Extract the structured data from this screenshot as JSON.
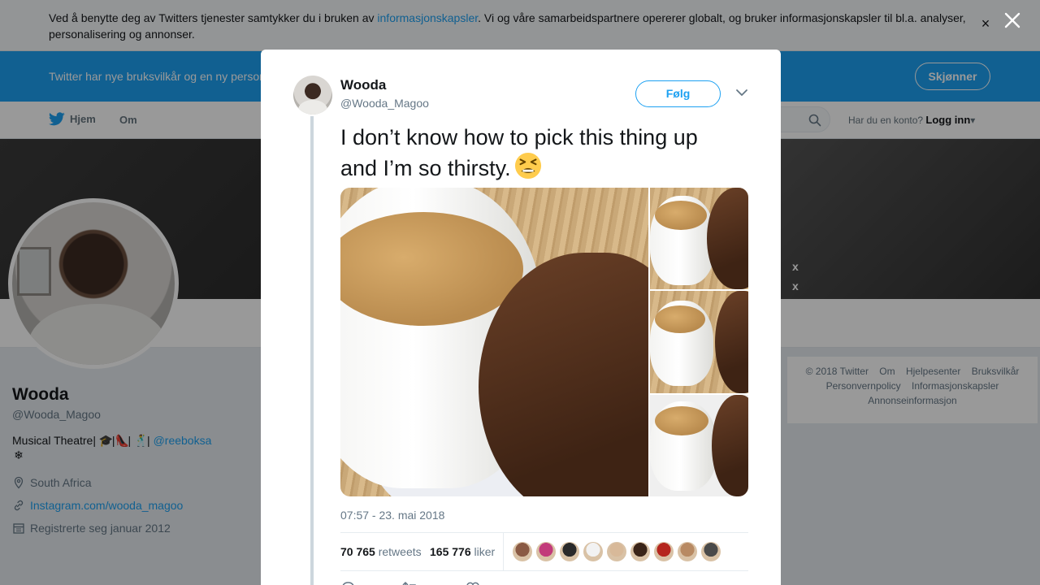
{
  "cookie_banner": {
    "text_before": "Ved å benytte deg av Twitters tjenester samtykker du i bruken av ",
    "link": "informasjonskapsler",
    "text_after": ". Vi og våre samarbeidspartnere opererer globalt, og bruker informasjonskapsler til bl.a. analyser, personalisering og annonser.",
    "close_icon": "close-icon"
  },
  "terms_bar": {
    "text": "Twitter har nye bruksvilkår og en ny personvernpolicy som trer i kraft 25. mai.",
    "button": "Skjønner"
  },
  "nav": {
    "home": "Hjem",
    "about": "Om",
    "login_prompt": "Har du en konto?",
    "login_link": "Logg inn"
  },
  "profile": {
    "name": "Wooda",
    "handle": "@Wooda_Magoo",
    "bio_text": "Musical Theatre|",
    "bio_mention": "@reeboksa",
    "location": "South Africa",
    "website": "Instagram.com/wooda_magoo",
    "joined": "Registrerte seg januar 2012"
  },
  "footer": {
    "links": [
      "© 2018 Twitter",
      "Om",
      "Hjelpesenter",
      "Bruksvilkår",
      "Personvernpolicy",
      "Informasjonskapsler",
      "Annonseinformasjon"
    ]
  },
  "tweet": {
    "author_name": "Wooda",
    "author_handle": "@Wooda_Magoo",
    "follow_label": "Følg",
    "text": "I don’t know how to pick this thing up and I’m so thirsty.",
    "timestamp": "07:57 - 23. mai 2018",
    "retweets_count": "70 765",
    "retweets_label": "retweets",
    "likes_count": "165 776",
    "likes_label": "liker",
    "liker_colors": [
      "#8a5a44",
      "#c23b7a",
      "#2a2a2a",
      "#f2f2f2",
      "#d8b999",
      "#3a2418",
      "#b5261e",
      "#b88a63",
      "#4a4a4a"
    ]
  },
  "colors": {
    "accent": "#1da1f2",
    "overlay": "rgba(0,0,0,0.40)"
  }
}
